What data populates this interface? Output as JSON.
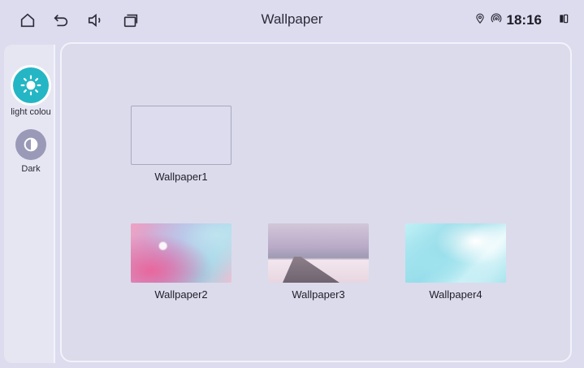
{
  "header": {
    "title": "Wallpaper",
    "time": "18:16",
    "icons": [
      "home-icon",
      "back-icon",
      "volume-icon",
      "recent-apps-icon",
      "location-icon",
      "hotspot-icon",
      "split-screen-icon"
    ]
  },
  "sidebar": {
    "modes": [
      {
        "label": "light colou",
        "icon": "sun-icon",
        "active": true
      },
      {
        "label": "Dark",
        "icon": "contrast-icon",
        "active": false
      }
    ]
  },
  "wallpapers": [
    {
      "label": "Wallpaper1"
    },
    {
      "label": "Wallpaper2"
    },
    {
      "label": "Wallpaper3"
    },
    {
      "label": "Wallpaper4"
    }
  ],
  "colors": {
    "accent": "#24b6c4",
    "background": "#dcdcee",
    "inactive_mode": "#9a9ab8"
  }
}
